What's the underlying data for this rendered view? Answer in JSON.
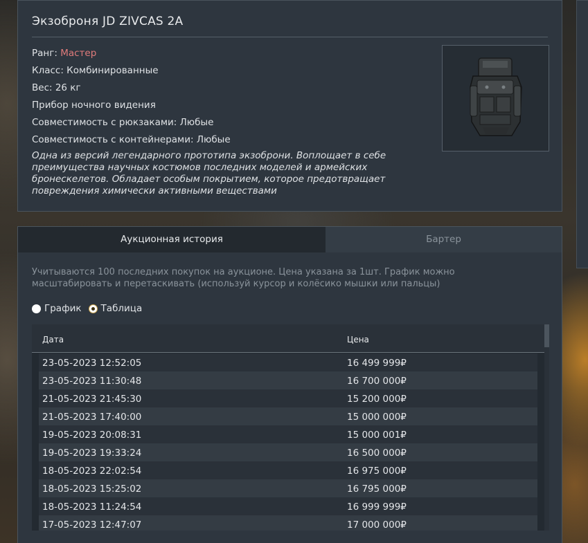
{
  "item": {
    "title": "Экзоброня JD ZIVCAS 2A",
    "rank_label": "Ранг: ",
    "rank_value": "Мастер",
    "rank_color": "#e07b7b",
    "class": "Класс: Комбинированные",
    "weight": "Вес: 26 кг",
    "night_vision": "Прибор ночного видения",
    "backpack_compat": "Совместимость с рюкзаками: Любые",
    "container_compat": "Совместимость с контейнерами: Любые",
    "description": "Одна из версий легендарного прототипа экзоброни. Воплощает в себе преимущества научных костюмов последних моделей и армейских бронескелетов. Обладает особым покрытием, которое предотвращает повреждения химически активными веществами"
  },
  "auction": {
    "tabs": [
      {
        "label": "Аукционная история",
        "active": true
      },
      {
        "label": "Бартер",
        "active": false
      }
    ],
    "note": "Учитываются 100 последних покупок на аукционе. Цена указана за 1шт. График можно масштабировать и перетаскивать (используй курсор и колёсико мышки или пальцы)",
    "view_options": [
      {
        "label": "График",
        "selected": false
      },
      {
        "label": "Таблица",
        "selected": true
      }
    ],
    "table": {
      "columns": [
        "Дата",
        "Цена"
      ],
      "rows": [
        [
          "23-05-2023 12:52:05",
          "16 499 999₽"
        ],
        [
          "23-05-2023 11:30:48",
          "16 700 000₽"
        ],
        [
          "21-05-2023 21:45:30",
          "15 200 000₽"
        ],
        [
          "21-05-2023 17:40:00",
          "15 000 000₽"
        ],
        [
          "19-05-2023 20:08:31",
          "15 000 001₽"
        ],
        [
          "19-05-2023 19:33:24",
          "16 500 000₽"
        ],
        [
          "18-05-2023 22:02:54",
          "16 975 000₽"
        ],
        [
          "18-05-2023 15:25:02",
          "16 795 000₽"
        ],
        [
          "18-05-2023 11:24:54",
          "16 999 999₽"
        ],
        [
          "17-05-2023 12:47:07",
          "17 000 000₽"
        ]
      ]
    }
  }
}
